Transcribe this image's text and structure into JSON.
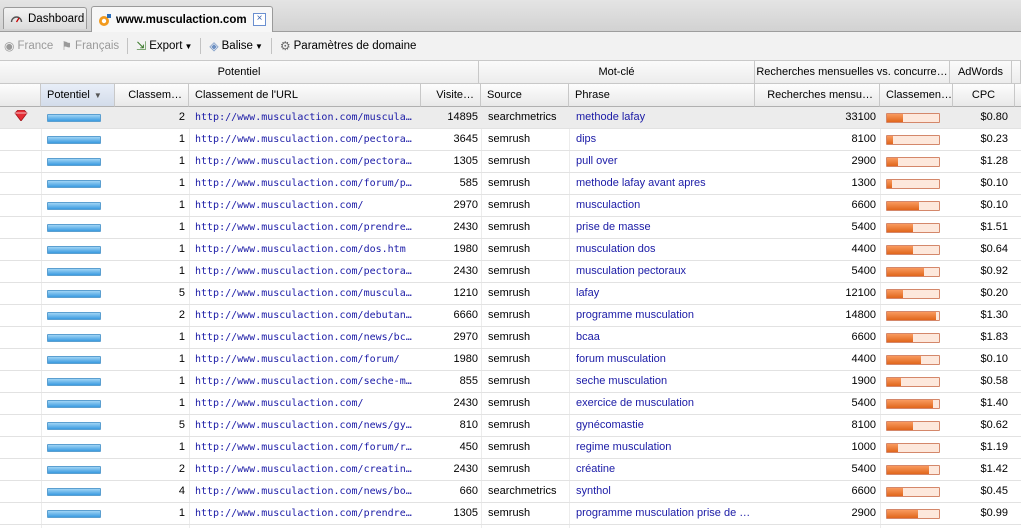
{
  "tabs": [
    {
      "label": "Dashboard",
      "icon": "dashboard-icon"
    },
    {
      "label": "www.musculaction.com",
      "icon": "site-icon",
      "active": true
    }
  ],
  "toolbar": {
    "country": "France",
    "language": "Français",
    "export": "Export",
    "tag": "Balise",
    "domain_settings": "Paramètres de domaine"
  },
  "groups": {
    "potentiel": "Potentiel",
    "motcle": "Mot-clé",
    "recherches": "Recherches mensuelles vs. concurre…",
    "adwords": "AdWords"
  },
  "columns": {
    "potentiel": "Potentiel",
    "classement": "Classem…",
    "classement_url": "Classement de l'URL",
    "visites": "Visite…",
    "source": "Source",
    "phrase": "Phrase",
    "recherches": "Recherches mensu…",
    "classement2": "Classemen…",
    "cpc": "CPC"
  },
  "rows": [
    {
      "rank": "2",
      "url": "http://www.musculaction.com/musculatio…",
      "visits": "14895",
      "source": "searchmetrics",
      "phrase": "methode lafay",
      "searches": "33100",
      "comp": 0.3,
      "cpc": "$0.80",
      "top": true
    },
    {
      "rank": "1",
      "url": "http://www.musculaction.com/pectoraux-…",
      "visits": "3645",
      "source": "semrush",
      "phrase": "dips",
      "searches": "8100",
      "comp": 0.12,
      "cpc": "$0.23"
    },
    {
      "rank": "1",
      "url": "http://www.musculaction.com/pectoraux-…",
      "visits": "1305",
      "source": "semrush",
      "phrase": "pull over",
      "searches": "2900",
      "comp": 0.22,
      "cpc": "$1.28"
    },
    {
      "rank": "1",
      "url": "http://www.musculaction.com/forum/pho…",
      "visits": "585",
      "source": "semrush",
      "phrase": "methode lafay avant apres",
      "searches": "1300",
      "comp": 0.1,
      "cpc": "$0.10"
    },
    {
      "rank": "1",
      "url": "http://www.musculaction.com/",
      "visits": "2970",
      "source": "semrush",
      "phrase": "musculaction",
      "searches": "6600",
      "comp": 0.62,
      "cpc": "$0.10"
    },
    {
      "rank": "1",
      "url": "http://www.musculaction.com/prendre_m…",
      "visits": "2430",
      "source": "semrush",
      "phrase": "prise de masse",
      "searches": "5400",
      "comp": 0.5,
      "cpc": "$1.51"
    },
    {
      "rank": "1",
      "url": "http://www.musculaction.com/dos.htm",
      "visits": "1980",
      "source": "semrush",
      "phrase": "musculation dos",
      "searches": "4400",
      "comp": 0.5,
      "cpc": "$0.64"
    },
    {
      "rank": "1",
      "url": "http://www.musculaction.com/pectoraux.…",
      "visits": "2430",
      "source": "semrush",
      "phrase": "musculation pectoraux",
      "searches": "5400",
      "comp": 0.72,
      "cpc": "$0.92"
    },
    {
      "rank": "5",
      "url": "http://www.musculaction.com/musculatio…",
      "visits": "1210",
      "source": "semrush",
      "phrase": "lafay",
      "searches": "12100",
      "comp": 0.3,
      "cpc": "$0.20"
    },
    {
      "rank": "2",
      "url": "http://www.musculaction.com/debutant-…",
      "visits": "6660",
      "source": "semrush",
      "phrase": "programme musculation",
      "searches": "14800",
      "comp": 0.95,
      "cpc": "$1.30"
    },
    {
      "rank": "1",
      "url": "http://www.musculaction.com/news/bcaa…",
      "visits": "2970",
      "source": "semrush",
      "phrase": "bcaa",
      "searches": "6600",
      "comp": 0.5,
      "cpc": "$1.83"
    },
    {
      "rank": "1",
      "url": "http://www.musculaction.com/forum/",
      "visits": "1980",
      "source": "semrush",
      "phrase": "forum musculation",
      "searches": "4400",
      "comp": 0.65,
      "cpc": "$0.10"
    },
    {
      "rank": "1",
      "url": "http://www.musculaction.com/seche-musc…",
      "visits": "855",
      "source": "semrush",
      "phrase": "seche musculation",
      "searches": "1900",
      "comp": 0.27,
      "cpc": "$0.58"
    },
    {
      "rank": "1",
      "url": "http://www.musculaction.com/",
      "visits": "2430",
      "source": "semrush",
      "phrase": "exercice de musculation",
      "searches": "5400",
      "comp": 0.88,
      "cpc": "$1.40"
    },
    {
      "rank": "5",
      "url": "http://www.musculaction.com/news/gyne…",
      "visits": "810",
      "source": "semrush",
      "phrase": "gynécomastie",
      "searches": "8100",
      "comp": 0.5,
      "cpc": "$0.62"
    },
    {
      "rank": "1",
      "url": "http://www.musculaction.com/forum/regi…",
      "visits": "450",
      "source": "semrush",
      "phrase": "regime musculation",
      "searches": "1000",
      "comp": 0.22,
      "cpc": "$1.19"
    },
    {
      "rank": "2",
      "url": "http://www.musculaction.com/creatine.htm",
      "visits": "2430",
      "source": "semrush",
      "phrase": "créatine",
      "searches": "5400",
      "comp": 0.8,
      "cpc": "$1.42"
    },
    {
      "rank": "4",
      "url": "http://www.musculaction.com/news/body…",
      "visits": "660",
      "source": "searchmetrics",
      "phrase": "synthol",
      "searches": "6600",
      "comp": 0.3,
      "cpc": "$0.45"
    },
    {
      "rank": "1",
      "url": "http://www.musculaction.com/prendre_m…",
      "visits": "1305",
      "source": "semrush",
      "phrase": "programme musculation prise de …",
      "searches": "2900",
      "comp": 0.6,
      "cpc": "$0.99"
    }
  ]
}
